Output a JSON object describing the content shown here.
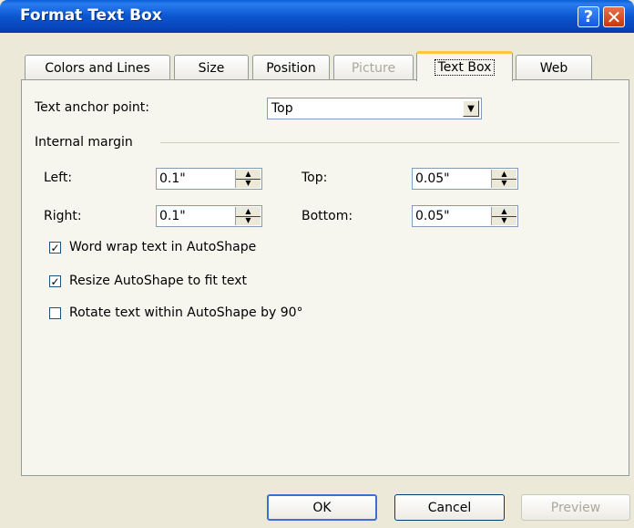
{
  "window": {
    "title": "Format Text Box"
  },
  "titlebar": {
    "help_label": "?",
    "close_label": "✕"
  },
  "tabs": [
    {
      "label": "Colors and Lines"
    },
    {
      "label": "Size"
    },
    {
      "label": "Position"
    },
    {
      "label": "Picture",
      "disabled": true
    },
    {
      "label": "Text Box",
      "active": true
    },
    {
      "label": "Web"
    }
  ],
  "anchor": {
    "label": "Text anchor point:",
    "value": "Top"
  },
  "margins": {
    "heading": "Internal margin",
    "left": {
      "label": "Left:",
      "value": "0.1\""
    },
    "right": {
      "label": "Right:",
      "value": "0.1\""
    },
    "top": {
      "label": "Top:",
      "value": "0.05\""
    },
    "bottom": {
      "label": "Bottom:",
      "value": "0.05\""
    }
  },
  "options": {
    "word_wrap": {
      "label": "Word wrap text in AutoShape",
      "checked": true
    },
    "resize": {
      "label": "Resize AutoShape to fit text",
      "checked": true
    },
    "rotate": {
      "label": "Rotate text within AutoShape by 90°",
      "checked": false
    }
  },
  "buttons": {
    "ok": "OK",
    "cancel": "Cancel",
    "preview": "Preview"
  },
  "glyphs": {
    "check": "✓",
    "dropdown": "▼",
    "spin_up": "▲",
    "spin_down": "▼"
  },
  "colors": {
    "title_bar": "#0b56d0",
    "dialog_bg": "#ece9d8",
    "active_tab_accent": "#ffc83c"
  }
}
